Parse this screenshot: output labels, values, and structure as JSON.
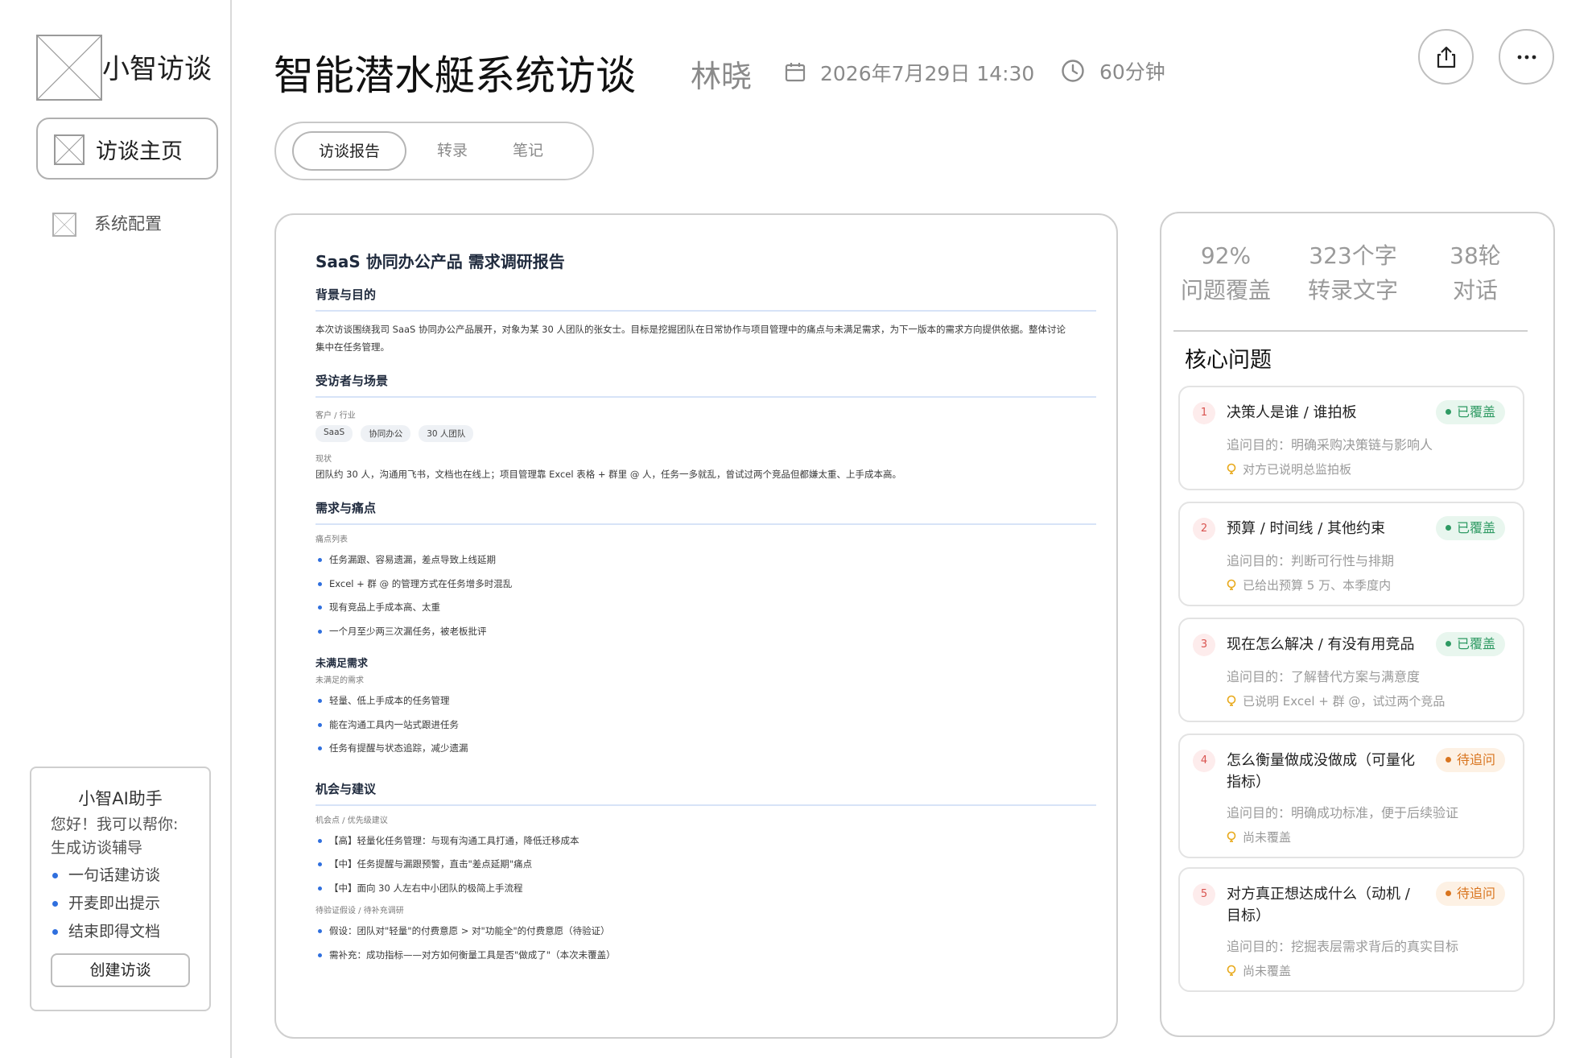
{
  "sidebar": {
    "logo_text": "小智访谈",
    "nav": [
      {
        "label": "访谈主页",
        "active": true
      },
      {
        "label": "系统配置",
        "active": false
      }
    ],
    "assistant": {
      "title": "小智AI助手",
      "greeting_line1": "您好！我可以帮你:",
      "greeting_line2": "生成访谈辅导",
      "features": [
        "一句话建访谈",
        "开麦即出提示",
        "结束即得文档"
      ],
      "button_label": "创建访谈"
    }
  },
  "header": {
    "title": "智能潜水艇系统访谈",
    "interviewee": "林晓",
    "datetime": "2026年7月29日 14:30",
    "duration": "60分钟",
    "share_icon": "share-icon",
    "more_icon": "more-icon"
  },
  "tabs": [
    {
      "label": "访谈报告",
      "active": true
    },
    {
      "label": "转录",
      "active": false
    },
    {
      "label": "笔记",
      "active": false
    }
  ],
  "report": {
    "title": "SaaS 协同办公产品 需求调研报告",
    "background": {
      "heading": "背景与目的",
      "body": "本次访谈围绕我司 SaaS 协同办公产品展开，对象为某 30 人团队的张女士。目标是挖掘团队在日常协作与项目管理中的痛点与未满足需求，为下一版本的需求方向提供依据。整体讨论",
      "body2": "集中在任务管理。"
    },
    "interviewee": {
      "heading": "受访者与场景",
      "industry_label": "客户 / 行业",
      "chips": [
        "SaaS",
        "协同办公",
        "30 人团队"
      ],
      "status_label": "现状",
      "status_text": "团队约 30 人，沟通用飞书，文档也在线上；项目管理靠 Excel 表格 + 群里 @ 人，任务一多就乱，曾试过两个竞品但都嫌太重、上手成本高。"
    },
    "needs": {
      "heading": "需求与痛点",
      "pain_label": "痛点列表",
      "pains": [
        "任务漏跟、容易遗漏，差点导致上线延期",
        "Excel + 群 @ 的管理方式在任务增多时混乱",
        "现有竞品上手成本高、太重",
        "一个月至少两三次漏任务，被老板批评"
      ],
      "unmet_heading": "未满足需求",
      "unmet_label": "未满足的需求",
      "unmet": [
        "轻量、低上手成本的任务管理",
        "能在沟通工具内一站式跟进任务",
        "任务有提醒与状态追踪，减少遗漏"
      ]
    },
    "opportunities": {
      "heading": "机会与建议",
      "priority_label": "机会点 / 优先级建议",
      "items": [
        "【高】轻量化任务管理：与现有沟通工具打通，降低迁移成本",
        "【中】任务提醒与漏跟预警，直击\"差点延期\"痛点",
        "【中】面向 30 人左右中小团队的极简上手流程"
      ],
      "hypo_label": "待验证假设 / 待补充调研",
      "hypotheses": [
        "假设：团队对\"轻量\"的付费意愿 > 对\"功能全\"的付费意愿（待验证）",
        "需补充：成功指标——对方如何衡量工具是否\"做成了\"（本次未覆盖）"
      ]
    }
  },
  "stats": [
    {
      "value": "92%",
      "label": "问题覆盖"
    },
    {
      "value": "323个字",
      "label": "转录文字"
    },
    {
      "value": "38轮",
      "label": "对话"
    }
  ],
  "core": {
    "heading": "核心问题",
    "questions": [
      {
        "num": "1",
        "title": "决策人是谁 / 谁拍板",
        "status": "已覆盖",
        "status_type": "covered",
        "purpose": "追问目的：明确采购决策链与影响人",
        "note": "对方已说明总监拍板"
      },
      {
        "num": "2",
        "title": "预算 / 时间线 / 其他约束",
        "status": "已覆盖",
        "status_type": "covered",
        "purpose": "追问目的：判断可行性与排期",
        "note": "已给出预算 5 万、本季度内"
      },
      {
        "num": "3",
        "title": "现在怎么解决 / 有没有用竞品",
        "status": "已覆盖",
        "status_type": "covered",
        "purpose": "追问目的：了解替代方案与满意度",
        "note": "已说明 Excel + 群 @，试过两个竞品"
      },
      {
        "num": "4",
        "title": "怎么衡量做成没做成（可量化指标）",
        "status": "待追问",
        "status_type": "pending",
        "purpose": "追问目的：明确成功标准，便于后续验证",
        "note": "尚未覆盖"
      },
      {
        "num": "5",
        "title": "对方真正想达成什么（动机 / 目标）",
        "status": "待追问",
        "status_type": "pending",
        "purpose": "追问目的：挖掘表层需求背后的真实目标",
        "note": "尚未覆盖"
      }
    ]
  },
  "colors": {
    "accent_blue": "#2f6fde",
    "covered_green": "#2e9a63",
    "pending_orange": "#d9751f",
    "number_red": "#d9534f"
  }
}
